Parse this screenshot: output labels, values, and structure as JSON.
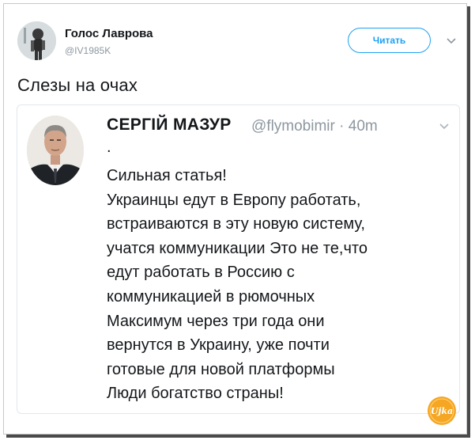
{
  "tweet": {
    "author": {
      "display_name": "Голос Лаврова",
      "handle": "@IV1985K"
    },
    "follow_button_label": "Читать",
    "text": "Слезы на очах"
  },
  "quoted_tweet": {
    "author": {
      "display_name": "СЕРГІЙ  МАЗУР",
      "handle": "@flymobimir",
      "time": "· 40m"
    },
    "dot_line": ".",
    "lines": [
      "Сильная статья!",
      "Украинцы едут в Европу работать,",
      "встраиваются в эту новую систему,",
      "учатся коммуникации Это не те,что",
      "едут работать в Россию с",
      "коммуникацией в рюмочных",
      "Максимум через три года они",
      "вернутся в Украину, уже почти",
      "готовые для новой платформы",
      "Люди богатство страны!"
    ]
  },
  "watermark_text": "Ujka",
  "colors": {
    "accent": "#1da1f2",
    "text": "#14171a",
    "muted": "#8d979f",
    "border": "#e1e8ed",
    "watermark": "#f5a623"
  },
  "icons": [
    "user-avatar",
    "chevron-down-icon",
    "quoted-user-avatar",
    "watermark-logo"
  ]
}
